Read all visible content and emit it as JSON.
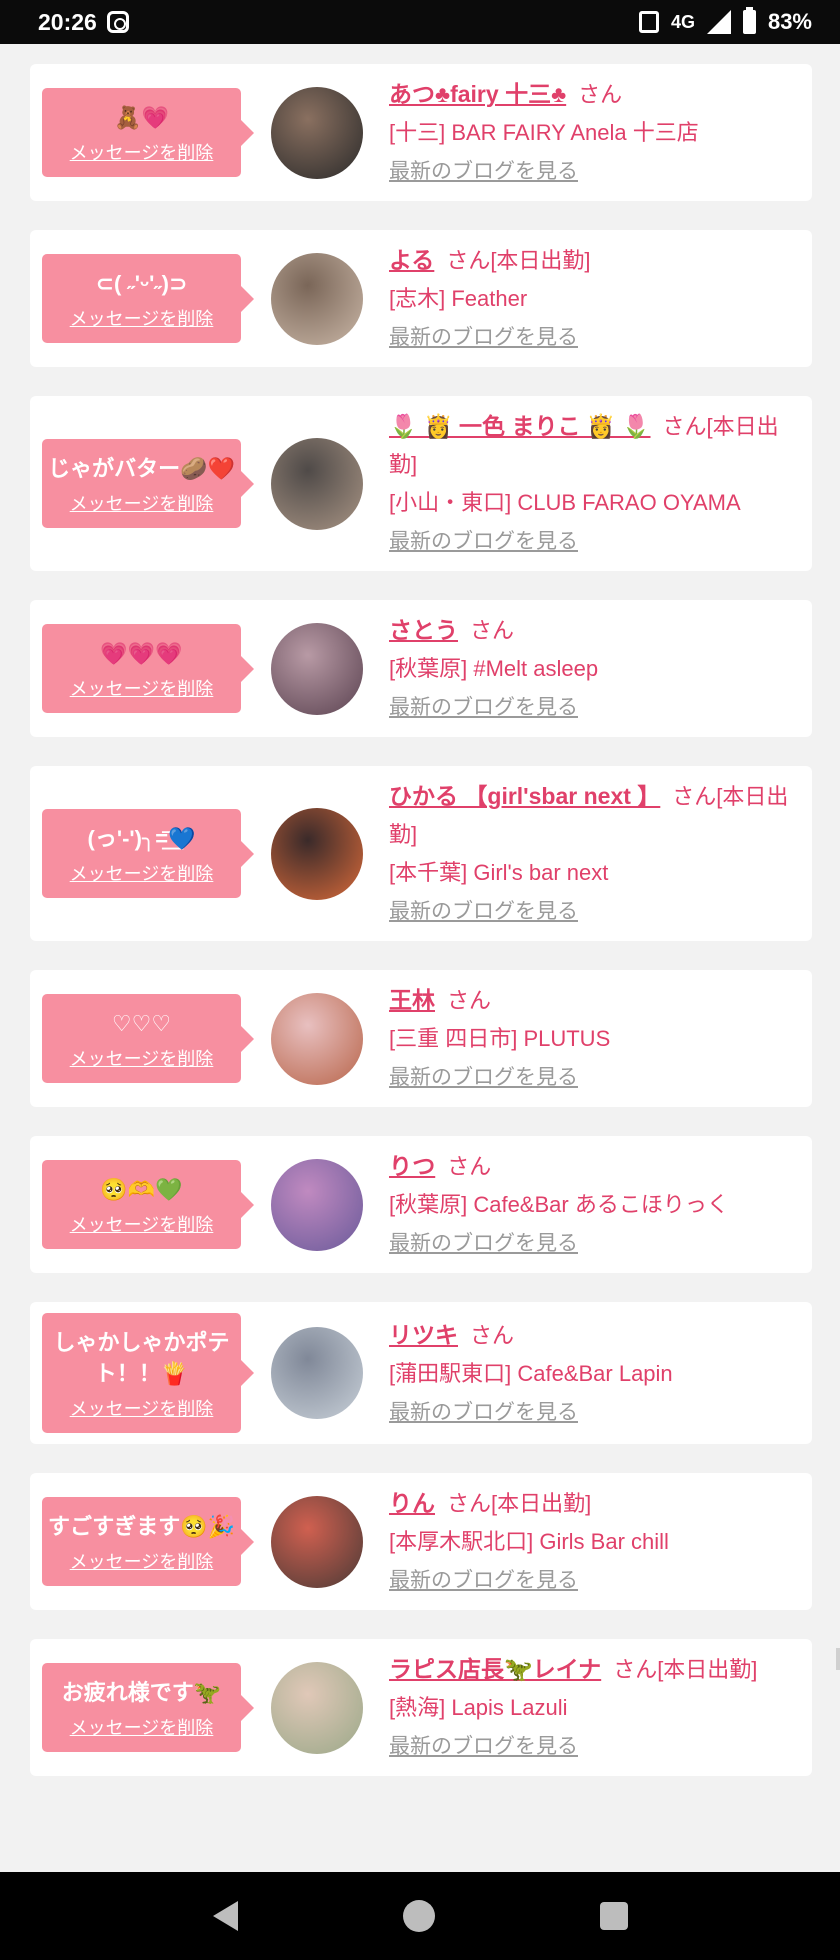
{
  "status_bar": {
    "time": "20:26",
    "network": "4G",
    "battery": "83%"
  },
  "delete_label": "メッセージを削除",
  "san_label": "さん",
  "blog_link": "最新のブログを見る",
  "cards": [
    {
      "message": "🧸💗",
      "name": "あつ♣fairy 十三♣",
      "suffix": "さん",
      "shop": "[十三] BAR FAIRY Anela 十三店",
      "avatar_colors": [
        "#2a2a2a",
        "#8a7060"
      ]
    },
    {
      "message": "⊂( ˶'ᵕ'˶)⊃",
      "name": "よる",
      "suffix": "さん[本日出勤]",
      "shop": "[志木] Feather",
      "avatar_colors": [
        "#c9b6a6",
        "#7a6658"
      ]
    },
    {
      "message": "じゃがバター🥔❤️",
      "name": "🌷 👸 一色 まりこ 👸 🌷",
      "suffix": "さん[本日出勤]",
      "shop": "[小山・東口] CLUB FARAO OYAMA",
      "avatar_colors": [
        "#a89484",
        "#4f4a48"
      ]
    },
    {
      "message": "💗💗💗",
      "name": "さとう",
      "suffix": "さん",
      "shop": "[秋葉原] #Melt asleep",
      "avatar_colors": [
        "#5a4250",
        "#b89aa5"
      ]
    },
    {
      "message": "(っ'-')╮=͟͟͞💙",
      "name": "ひかる 【girl'sbar next 】",
      "suffix": "さん[本日出勤]",
      "shop": "[本千葉] Girl's bar next",
      "avatar_colors": [
        "#d86a3a",
        "#3a2a2a"
      ]
    },
    {
      "message": "♡♡♡",
      "name": "王林",
      "suffix": "さん",
      "shop": "[三重 四日市] PLUTUS",
      "avatar_colors": [
        "#b8654a",
        "#e8c0c0"
      ]
    },
    {
      "message": "🥺🫶💚",
      "name": "りつ",
      "suffix": "さん",
      "shop": "[秋葉原] Cafe&Bar あるこほりっく",
      "avatar_colors": [
        "#6a5a9a",
        "#c08ac0"
      ]
    },
    {
      "message": "しゃかしゃかポテト！！🍟",
      "name": "リツキ",
      "suffix": "さん",
      "shop": "[蒲田駅東口] Cafe&Bar Lapin",
      "avatar_colors": [
        "#c8d0d8",
        "#808898"
      ]
    },
    {
      "message": "すごすぎます🥺🎉",
      "name": "りん",
      "suffix": "さん[本日出勤]",
      "shop": "[本厚木駅北口] Girls Bar chill",
      "avatar_colors": [
        "#4a3a36",
        "#d06050"
      ]
    },
    {
      "message": "お疲れ様です🦖",
      "name": "ラピス店長🦖レイナ",
      "suffix": "さん[本日出勤]",
      "shop": "[熱海] Lapis Lazuli",
      "avatar_colors": [
        "#9aa888",
        "#e0c8b8"
      ]
    }
  ]
}
